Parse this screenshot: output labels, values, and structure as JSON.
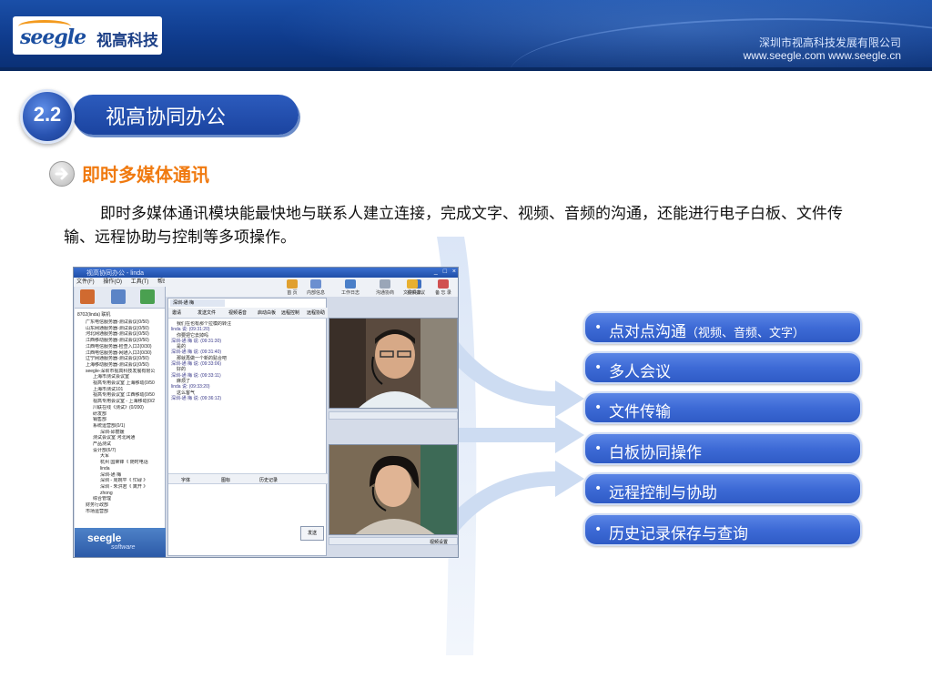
{
  "header": {
    "logo_en": "seegle",
    "logo_cn": "视高科技",
    "company_name": "深圳市视高科技发展有限公司",
    "company_urls": "www.seegle.com  www.seegle.cn"
  },
  "section": {
    "number": "2.2",
    "title": "视高协同办公"
  },
  "subsection": {
    "title": "即时多媒体通讯"
  },
  "description": "即时多媒体通讯模块能最快地与联系人建立连接，完成文字、视频、音频的沟通，还能进行电子白板、文件传输、远程协助与控制等多项操作。",
  "screenshot": {
    "window_title": "视高协同办公 - linda",
    "menu": [
      "文件(F)",
      "操作(O)",
      "工具(T)",
      "帮助(H)"
    ],
    "toolbar": [
      "首 页",
      "内部信息",
      "工作日志",
      "沟通协商",
      "视频会议",
      "备 忘 录",
      "文件共享"
    ],
    "contact_header": "8702(linda) 联机",
    "tree": [
      {
        "level": 1,
        "text": "广东电信服务器-测试会议(0/50)"
      },
      {
        "level": 1,
        "text": "山东网通服务器-测试会议(0/50)"
      },
      {
        "level": 1,
        "text": "河北网通服务器-测试会议(0/50)"
      },
      {
        "level": 1,
        "text": "江西移动服务器-测试会议(0/50)"
      },
      {
        "level": 1,
        "text": "江西电信服务器-检查入口2(0/30)"
      },
      {
        "level": 1,
        "text": "江西电信服务器-网通入口2(0/30)"
      },
      {
        "level": 1,
        "text": "辽宁网通服务器-测试会议(0/50)"
      },
      {
        "level": 1,
        "text": "上海移动服务器-测试会议(0/50)"
      },
      {
        "level": 1,
        "text": "seegle-深圳市视高科技发展有限公"
      },
      {
        "level": 2,
        "text": "上海市测试会议室"
      },
      {
        "level": 2,
        "text": "视高专用会议室 上海移动(0/50"
      },
      {
        "level": 2,
        "text": "上海市测试101"
      },
      {
        "level": 2,
        "text": "视高专用会议室 江西移动(0/50"
      },
      {
        "level": 2,
        "text": "视高专用会议室 - 上海移动(0/2"
      },
      {
        "level": 2,
        "text": "川联在线《测试》(0/200)"
      },
      {
        "level": 2,
        "text": "研发部"
      },
      {
        "level": 2,
        "text": "销售部"
      },
      {
        "level": 2,
        "text": "系统运营部(0/1)"
      },
      {
        "level": 3,
        "text": "深圳-邱丽媛"
      },
      {
        "level": 2,
        "text": "测试会议室 河北网通"
      },
      {
        "level": 2,
        "text": "产品测试"
      },
      {
        "level": 2,
        "text": "设计部(6/7)"
      },
      {
        "level": 3,
        "text": "大军"
      },
      {
        "level": 3,
        "text": "杭州 国荣锋《 随时电话"
      },
      {
        "level": 3,
        "text": "linda"
      },
      {
        "level": 3,
        "text": "深圳-通 梅"
      },
      {
        "level": 3,
        "text": "深圳 - 周婉平《 忙碌 》"
      },
      {
        "level": 3,
        "text": "深圳 - 朱洪君《 离开 》"
      },
      {
        "level": 3,
        "text": "zhong"
      },
      {
        "level": 2,
        "text": "综合管理"
      },
      {
        "level": 1,
        "text": "财务行政部"
      },
      {
        "level": 1,
        "text": "市场运营部"
      }
    ],
    "chat_tab": "深圳-通 梅",
    "chat_tools": [
      "邀请",
      "发送文件",
      "视频语音",
      "启动白板",
      "远程控制",
      "远程协助"
    ],
    "chat_log": [
      {
        "type": "msg",
        "text": "我们在也有那个拉模的转注"
      },
      {
        "type": "head",
        "text": "linda 说: (09:31:20)"
      },
      {
        "type": "msg",
        "text": "你要把它去掉吗"
      },
      {
        "type": "head",
        "text": "深圳-通 梅 说: (09:31:30)"
      },
      {
        "type": "msg",
        "text": "是的"
      },
      {
        "type": "head",
        "text": "深圳-通 梅 说: (09:31:40)"
      },
      {
        "type": "msg",
        "text": "那就再做一个新的贴合吧"
      },
      {
        "type": "head",
        "text": "深圳-通 梅 说: (09:33:06)"
      },
      {
        "type": "msg",
        "text": "好的"
      },
      {
        "type": "head",
        "text": "深圳-通 梅 说: (09:33:11)"
      },
      {
        "type": "msg",
        "text": "麻烦了"
      },
      {
        "type": "head",
        "text": "linda 说: (09:33:20)"
      },
      {
        "type": "msg",
        "text": "这么客气"
      },
      {
        "type": "head",
        "text": "深圳-通 梅 说: (09:36:12)"
      }
    ],
    "chat_bottom": [
      "字体",
      "图标",
      "历史记录"
    ],
    "send_label": "发送",
    "video_settings": "视频设置",
    "footer_brand": "seegle",
    "footer_sub": "software"
  },
  "features": [
    {
      "label": "点对点沟通",
      "note": "（视频、音频、文字）"
    },
    {
      "label": "多人会议",
      "note": ""
    },
    {
      "label": "文件传输",
      "note": ""
    },
    {
      "label": "白板协同操作",
      "note": ""
    },
    {
      "label": "远程控制与协助",
      "note": ""
    },
    {
      "label": "历史记录保存与查询",
      "note": ""
    }
  ],
  "colors": {
    "header_blue": "#0f3b8c",
    "accent_orange": "#f07a10",
    "pill_blue": "#3d6ad6"
  }
}
